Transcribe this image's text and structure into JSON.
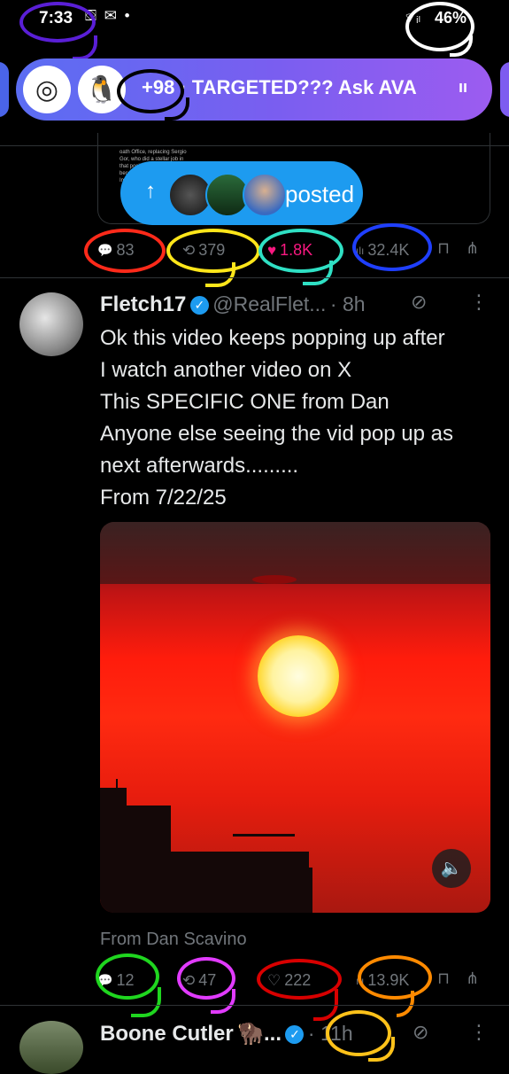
{
  "status_bar": {
    "time": "7:33",
    "left_icons": "⛋ ✉ •",
    "battery": "46%",
    "wifi": "⌔ᵢₗ"
  },
  "spaces": {
    "count": "+98",
    "separator": "·",
    "title": "TARGETED??? Ask AVA",
    "live_indicator": "ıı"
  },
  "posted_pill": {
    "arrow": "↑",
    "label": "posted"
  },
  "quoted_tweet_fragment": "oath Office, replacing Sergio Gor, who did a stellar job in that position, and will now become Ambassador to India...",
  "tweet1_actions": {
    "replies": "83",
    "reposts": "379",
    "likes": "1.8K",
    "views": "32.4K"
  },
  "tweet2": {
    "name": "Fletch17",
    "handle": "@RealFlet...",
    "time": "· 8h",
    "lines": [
      "Ok this video keeps popping up after",
      "I watch another video on X",
      "This SPECIFIC ONE from Dan",
      "Anyone else seeing the vid pop up as",
      "next afterwards.........",
      "From 7/22/25"
    ],
    "media_caption": "From Dan Scavino",
    "actions": {
      "replies": "12",
      "reposts": "47",
      "likes": "222",
      "views": "13.9K"
    }
  },
  "tweet3": {
    "name": "Boone Cutler",
    "name_suffix": "🦬...",
    "time": "· 11h"
  },
  "icons": {
    "reply": "💬",
    "repost": "⟲",
    "like": "♥",
    "like_outline": "♡",
    "views": "ılı",
    "bookmark": "⊓",
    "share": "⋔",
    "more": "⋮",
    "grok": "⊘",
    "volume": "🔈"
  },
  "annotation_colors": {
    "purple": "#5a1fd6",
    "white": "#ffffff",
    "black": "#000000",
    "red": "#ff2a1a",
    "yellow": "#ffe61a",
    "teal": "#2fe0c4",
    "blue": "#1f3fff",
    "green": "#1fd61f",
    "magenta": "#e13bff",
    "dark_red": "#d80000",
    "orange": "#ff8a00",
    "gold": "#ffc21a"
  }
}
